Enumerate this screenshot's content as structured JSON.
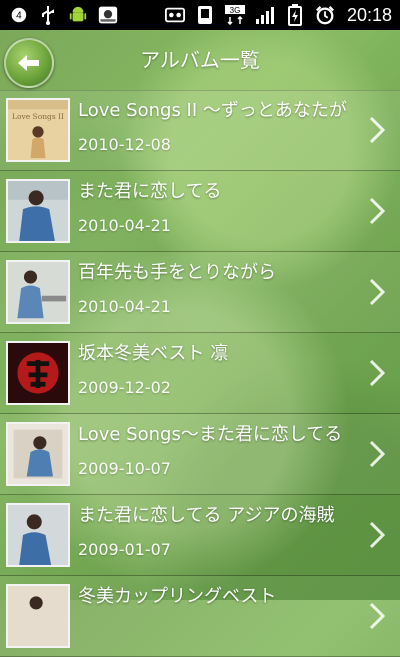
{
  "status_bar": {
    "time": "20:18",
    "network": "3G",
    "notifications": "4",
    "icons": [
      "notification-badge-icon",
      "usb-icon",
      "android-icon",
      "app-icon",
      "sd-card-icon",
      "phone-icon",
      "3g-icon",
      "signal-icon",
      "battery-icon",
      "alarm-icon"
    ]
  },
  "header": {
    "title": "アルバム一覧",
    "back_icon": "back-arrow-icon"
  },
  "albums": [
    {
      "title": "Love Songs II ～ずっとあなたが",
      "date": "2010-12-08"
    },
    {
      "title": "また君に恋してる",
      "date": "2010-04-21"
    },
    {
      "title": "百年先も手をとりながら",
      "date": "2010-04-21"
    },
    {
      "title": "坂本冬美ベスト 凛",
      "date": "2009-12-02"
    },
    {
      "title": "Love Songs～また君に恋してる",
      "date": "2009-10-07"
    },
    {
      "title": "また君に恋してる アジアの海賊",
      "date": "2009-01-07"
    },
    {
      "title": "冬美カップリングベスト",
      "date": ""
    }
  ],
  "icons": {
    "row_chevron": "chevron-right-icon"
  },
  "colors": {
    "background": "#6f9f4a",
    "status_bar": "#000000",
    "text": "#ffffff"
  }
}
